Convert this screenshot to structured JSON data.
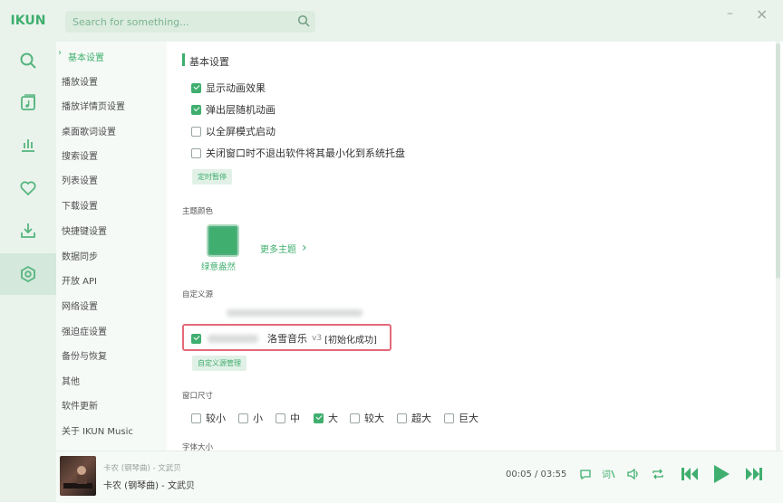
{
  "app": {
    "brand": "IKUN"
  },
  "search": {
    "placeholder": "Search for something..."
  },
  "window": {
    "minimize_label": "–",
    "close_label": "×"
  },
  "rail": {
    "items": [
      {
        "icon": "search-icon"
      },
      {
        "icon": "music-library-icon"
      },
      {
        "icon": "chart-icon"
      },
      {
        "icon": "heart-icon"
      },
      {
        "icon": "download-icon"
      },
      {
        "icon": "settings-icon",
        "active": true
      }
    ]
  },
  "nav": {
    "items": [
      {
        "label": "基本设置",
        "active": true
      },
      {
        "label": "播放设置"
      },
      {
        "label": "播放详情页设置"
      },
      {
        "label": "桌面歌词设置"
      },
      {
        "label": "搜索设置"
      },
      {
        "label": "列表设置"
      },
      {
        "label": "下载设置"
      },
      {
        "label": "快捷键设置"
      },
      {
        "label": "数据同步"
      },
      {
        "label": "开放 API"
      },
      {
        "label": "网络设置"
      },
      {
        "label": "强迫症设置"
      },
      {
        "label": "备份与恢复"
      },
      {
        "label": "其他"
      },
      {
        "label": "软件更新"
      },
      {
        "label": "关于 IKUN Music"
      }
    ]
  },
  "basic": {
    "title": "基本设置",
    "options": [
      {
        "label": "显示动画效果",
        "checked": true
      },
      {
        "label": "弹出层随机动画",
        "checked": true
      },
      {
        "label": "以全屏模式启动",
        "checked": false
      },
      {
        "label": "关闭窗口时不退出软件将其最小化到系统托盘",
        "checked": false
      }
    ],
    "timer_button": "定时暂停"
  },
  "theme": {
    "label": "主题颜色",
    "current_name": "绿意盎然",
    "color": "#3fae6e",
    "more_label": "更多主题",
    "more_arrow": "›"
  },
  "source": {
    "label": "自定义源",
    "name": "洛雪音乐",
    "version": "v3",
    "status": "[初始化成功]",
    "checked": true,
    "manage_button": "自定义源管理"
  },
  "window_size": {
    "label": "窗口尺寸",
    "options": [
      {
        "label": "较小",
        "checked": false
      },
      {
        "label": "小",
        "checked": false
      },
      {
        "label": "中",
        "checked": false
      },
      {
        "label": "大",
        "checked": true
      },
      {
        "label": "较大",
        "checked": false
      },
      {
        "label": "超大",
        "checked": false
      },
      {
        "label": "巨大",
        "checked": false
      }
    ]
  },
  "font_size": {
    "label": "字体大小"
  },
  "player": {
    "subtitle": "卡农 (钢琴曲) - 文武贝",
    "title": "卡农 (钢琴曲) - 文武贝",
    "time": "00:05 / 03:55"
  },
  "colors": {
    "accent": "#3fae6e",
    "highlight_box": "#e46a79"
  }
}
